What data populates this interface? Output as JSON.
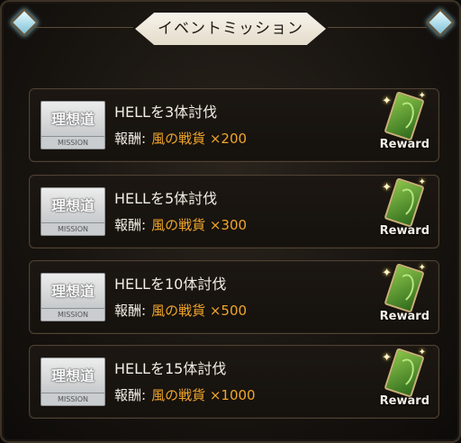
{
  "header": {
    "title": "イベントミッション"
  },
  "missions": [
    {
      "title": "HELLを3体討伐",
      "reward_label": "報酬:",
      "reward_value": "風の戦貨 ×200",
      "icon_text": "理想道",
      "icon_label": "MISSION",
      "reward_button": "Reward"
    },
    {
      "title": "HELLを5体討伐",
      "reward_label": "報酬:",
      "reward_value": "風の戦貨 ×300",
      "icon_text": "理想道",
      "icon_label": "MISSION",
      "reward_button": "Reward"
    },
    {
      "title": "HELLを10体討伐",
      "reward_label": "報酬:",
      "reward_value": "風の戦貨 ×500",
      "icon_text": "理想道",
      "icon_label": "MISSION",
      "reward_button": "Reward"
    },
    {
      "title": "HELLを15体討伐",
      "reward_label": "報酬:",
      "reward_value": "風の戦貨 ×1000",
      "icon_text": "理想道",
      "icon_label": "MISSION",
      "reward_button": "Reward"
    }
  ],
  "colors": {
    "reward_value": "#f0a52a",
    "card": "#5a9a33",
    "title_bg": "#f2ede2"
  },
  "icons": [
    "gem-icon",
    "reward-card-icon",
    "sparkle-icon"
  ]
}
